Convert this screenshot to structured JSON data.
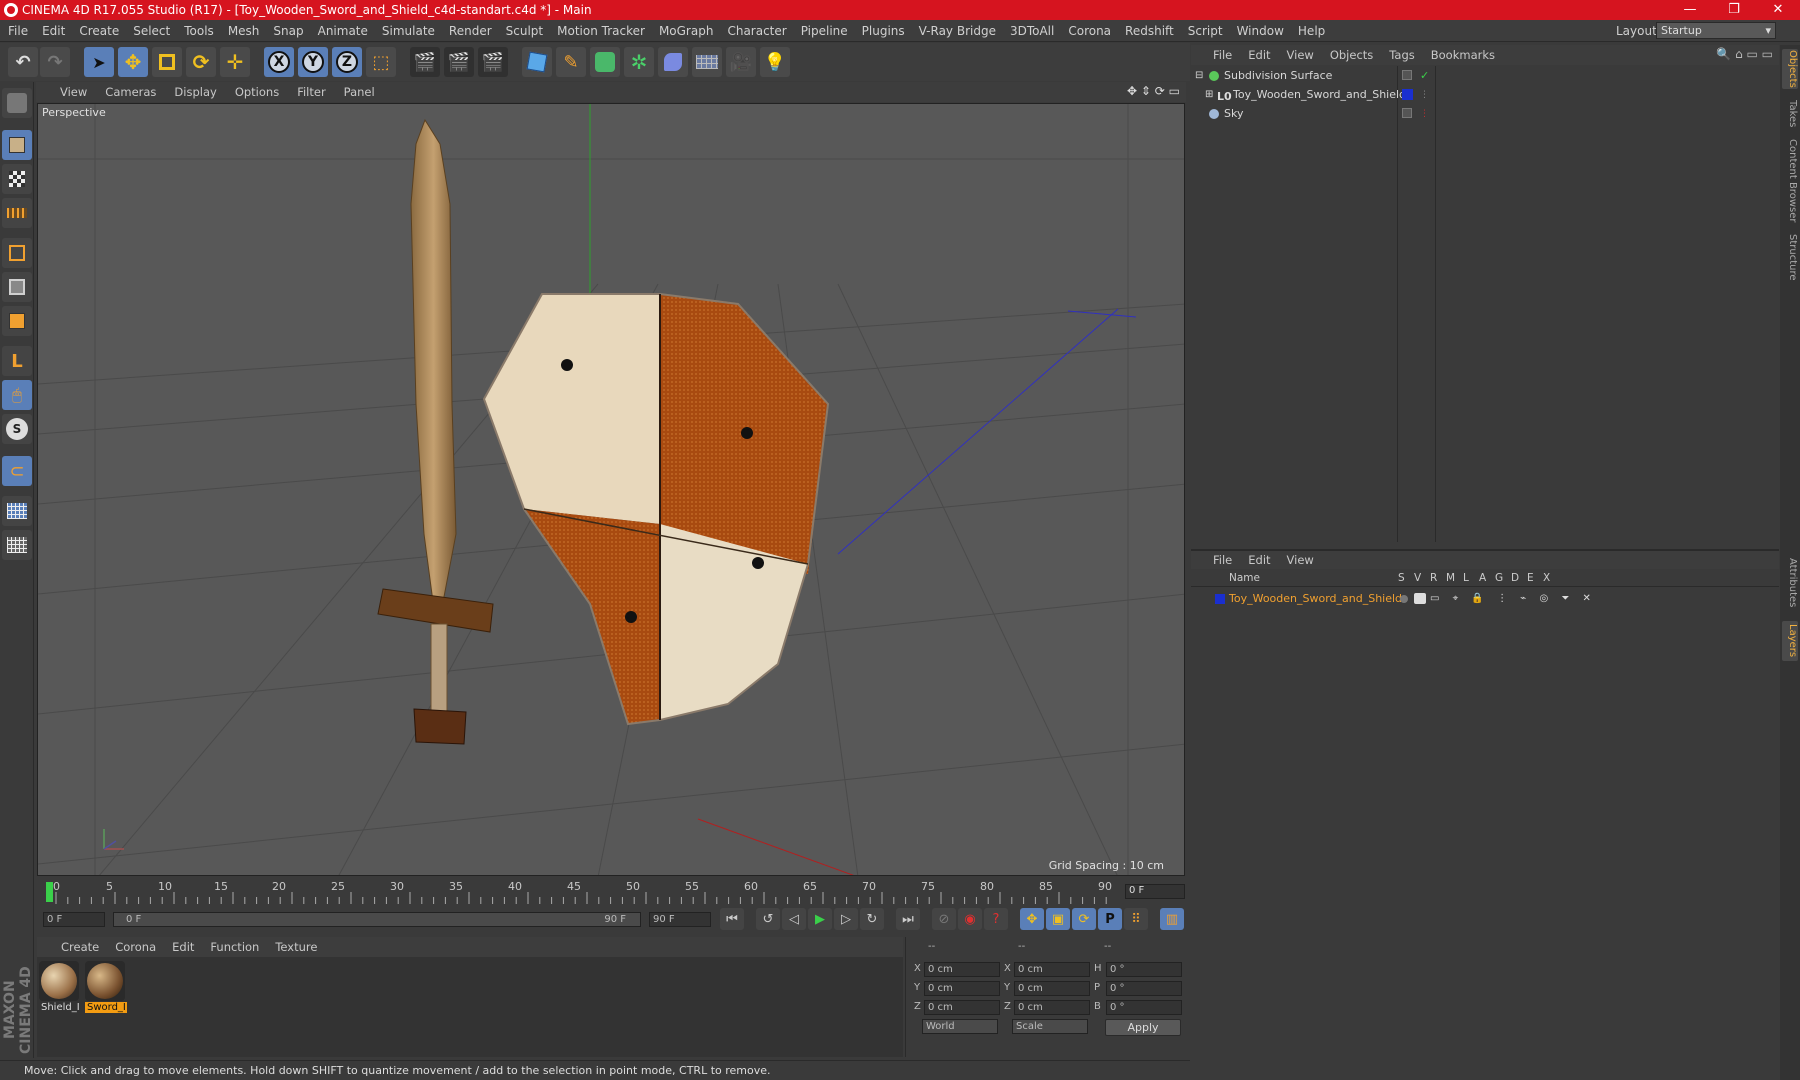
{
  "titlebar": {
    "title": "CINEMA 4D R17.055 Studio (R17) - [Toy_Wooden_Sword_and_Shield_c4d-standart.c4d *] - Main",
    "minimize": "—",
    "maximize": "❐",
    "close": "✕"
  },
  "menubar": {
    "items": [
      "File",
      "Edit",
      "Create",
      "Select",
      "Tools",
      "Mesh",
      "Snap",
      "Animate",
      "Simulate",
      "Render",
      "Sculpt",
      "Motion Tracker",
      "MoGraph",
      "Character",
      "Pipeline",
      "Plugins",
      "V-Ray Bridge",
      "3DToAll",
      "Corona",
      "Redshift",
      "Script",
      "Window",
      "Help"
    ],
    "layout_label": "Layout:",
    "layout_value": "Startup"
  },
  "toolbar": {
    "axis_x": "X",
    "axis_y": "Y",
    "axis_z": "Z"
  },
  "viewport": {
    "menu": [
      "View",
      "Cameras",
      "Display",
      "Options",
      "Filter",
      "Panel"
    ],
    "camera_label": "Perspective",
    "grid_spacing": "Grid Spacing : 10 cm"
  },
  "timeline": {
    "ticks": [
      "0",
      "5",
      "10",
      "15",
      "20",
      "25",
      "30",
      "35",
      "40",
      "45",
      "50",
      "55",
      "60",
      "65",
      "70",
      "75",
      "80",
      "85",
      "90"
    ],
    "current_frame": "0 F",
    "start_field": "0 F",
    "range_start": "0 F",
    "range_end": "90 F",
    "end_field": "90 F"
  },
  "materials": {
    "menu": [
      "Create",
      "Corona",
      "Edit",
      "Function",
      "Texture"
    ],
    "items": [
      {
        "label": "Shield_I",
        "color": "#b08060"
      },
      {
        "label": "Sword_I",
        "color": "#8a6040"
      }
    ]
  },
  "coordinates": {
    "header_1": "--",
    "header_2": "--",
    "header_3": "--",
    "rows": [
      {
        "a": "X",
        "av": "0 cm",
        "b": "X",
        "bv": "0 cm",
        "c": "H",
        "cv": "0 °"
      },
      {
        "a": "Y",
        "av": "0 cm",
        "b": "Y",
        "bv": "0 cm",
        "c": "P",
        "cv": "0 °"
      },
      {
        "a": "Z",
        "av": "0 cm",
        "b": "Z",
        "bv": "0 cm",
        "c": "B",
        "cv": "0 °"
      }
    ],
    "mode_world": "World",
    "mode_scale": "Scale",
    "apply": "Apply"
  },
  "statusbar": {
    "text": "Move: Click and drag to move elements. Hold down SHIFT to quantize movement / add to the selection in point mode, CTRL to remove."
  },
  "object_manager": {
    "menu": [
      "File",
      "Edit",
      "View",
      "Objects",
      "Tags",
      "Bookmarks"
    ],
    "objects": [
      {
        "name": "Subdivision Surface",
        "icon_color": "#5ac85a"
      },
      {
        "name": "Toy_Wooden_Sword_and_Shield",
        "icon_color": "#a0a0a0",
        "tag_color": "#1a2fd0"
      },
      {
        "name": "Sky",
        "icon_color": "#a0b8d8"
      }
    ]
  },
  "layer_manager": {
    "menu": [
      "File",
      "Edit",
      "View"
    ],
    "columns": [
      "Name",
      "S",
      "V",
      "R",
      "M",
      "L",
      "A",
      "G",
      "D",
      "E",
      "X"
    ],
    "layers": [
      {
        "name": "Toy_Wooden_Sword_and_Shield",
        "color": "#1a2fd0"
      }
    ]
  },
  "right_tabs": [
    "Objects",
    "Takes",
    "Content Browser",
    "Structure",
    "Attributes",
    "Layers"
  ],
  "branding": "MAXON CINEMA 4D",
  "colors": {
    "title_red": "#d6141f",
    "accent_blue": "#5a7fb8",
    "highlight_orange": "#f39c12"
  }
}
